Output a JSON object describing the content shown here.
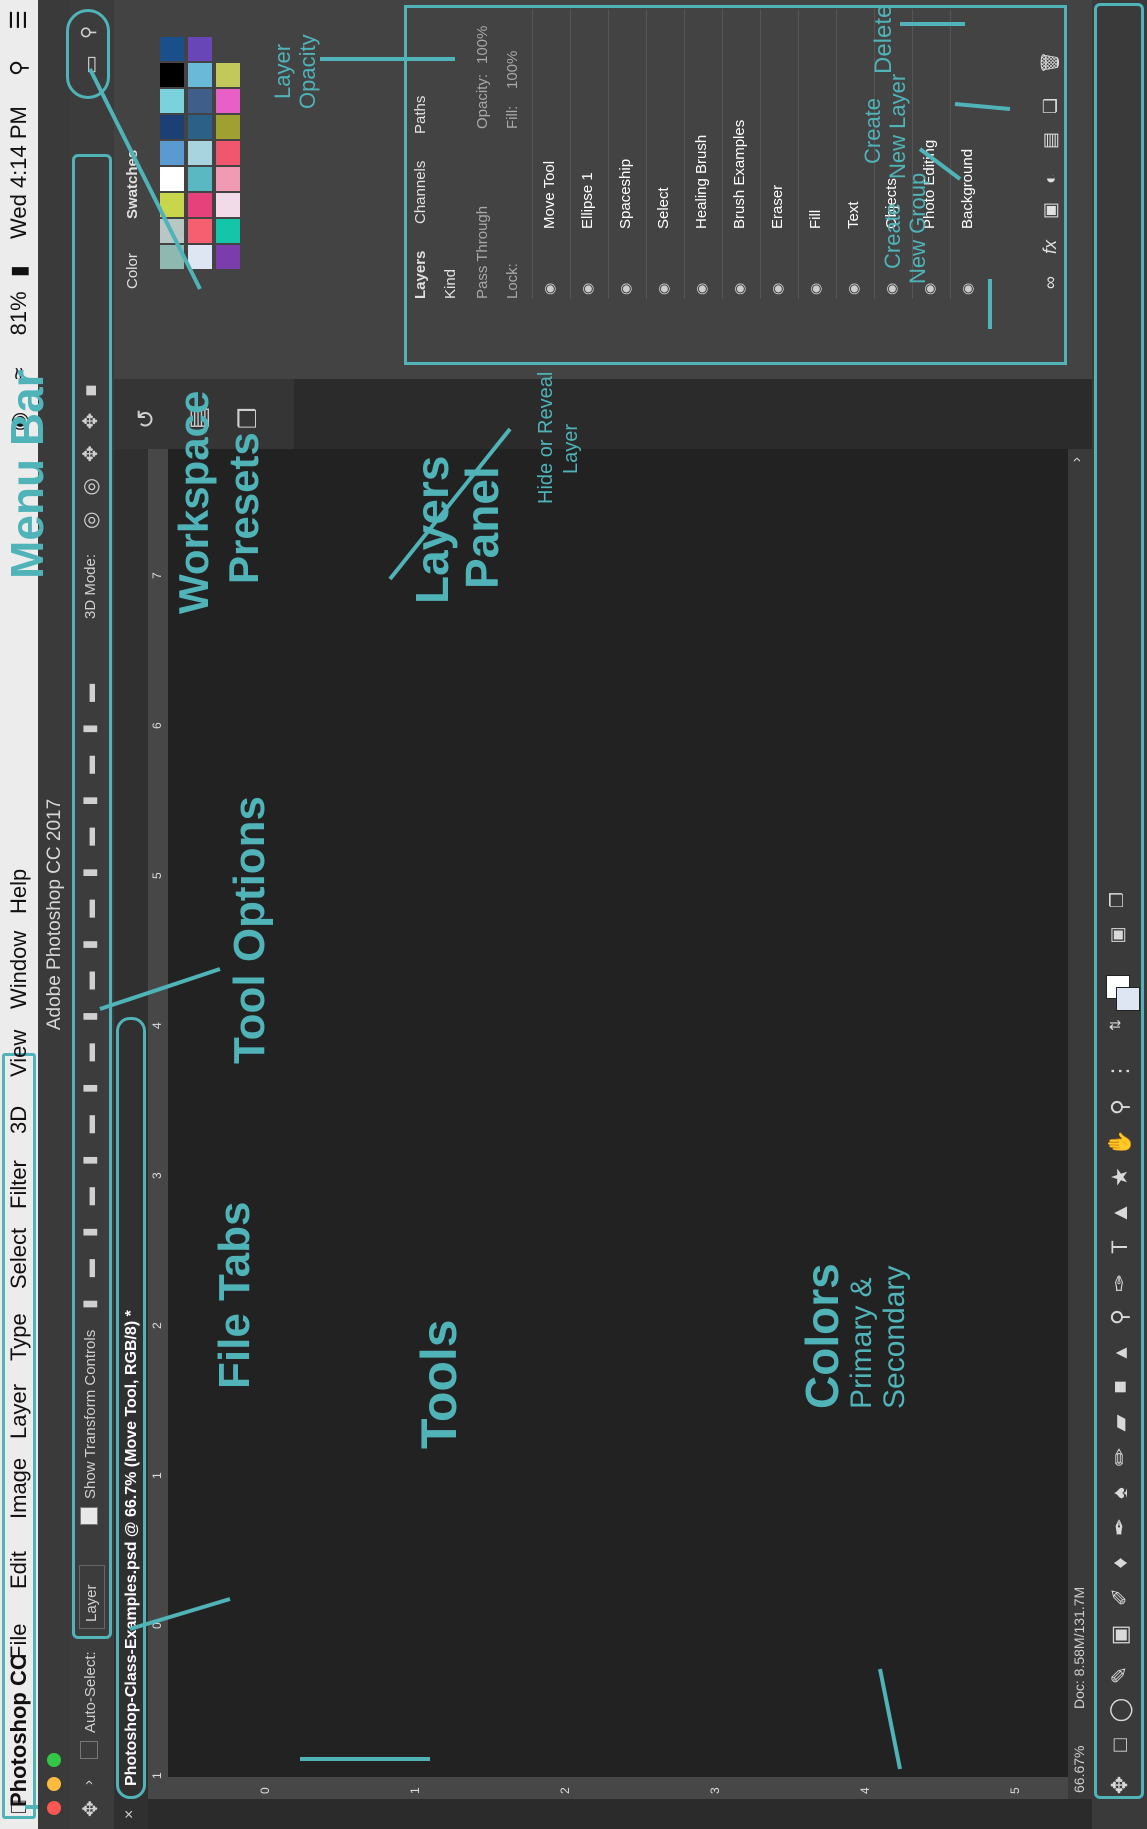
{
  "menubar": {
    "apple": "",
    "items": [
      "Photoshop CC",
      "File",
      "Edit",
      "Image",
      "Layer",
      "Type",
      "Select",
      "Filter",
      "3D",
      "View",
      "Window",
      "Help"
    ],
    "battery": "81%",
    "clock": "Wed 4:14 PM"
  },
  "app": {
    "title": "Adobe Photoshop CC 2017"
  },
  "options": {
    "auto_select_label": "Auto-Select:",
    "auto_select_value": "Layer",
    "transform_label": "Show Transform Controls",
    "mode_label": "3D Mode:"
  },
  "file_tab": {
    "label": "Photoshop-Class-Examples.psd @ 66.7% (Move Tool, RGB/8) *"
  },
  "status": {
    "zoom": "66.67%",
    "doc": "Doc: 8.58M/131.7M"
  },
  "ruler_ticks": [
    "1",
    "0",
    "1",
    "2",
    "3",
    "4",
    "5",
    "6",
    "7"
  ],
  "vruler_ticks": [
    "0",
    "1",
    "2",
    "3",
    "4",
    "5"
  ],
  "panels": {
    "top_tabs": [
      "Color",
      "Swatches"
    ],
    "layer_tabs": [
      "Layers",
      "Channels",
      "Paths"
    ],
    "kind": "Kind",
    "blend": "Pass Through",
    "opacity_label": "Opacity:",
    "opacity_value": "100%",
    "lock_label": "Lock:",
    "fill_label": "Fill:",
    "fill_value": "100%",
    "layers": [
      "Move Tool",
      "Ellipse 1",
      "Spaceship",
      "Select",
      "Healing Brush",
      "Brush Examples",
      "Eraser",
      "Fill",
      "Text",
      "Objects",
      "Photo Editing",
      "Background"
    ]
  },
  "swatch_colors": [
    "#8fb9b0",
    "#b9c7c4",
    "#c9d64b",
    "#ffffff",
    "#5b9ad0",
    "#1c3f74",
    "#7ad3dc",
    "#000000",
    "#1b4f8a",
    "#dfe6f3",
    "#f55f6f",
    "#e7417c",
    "#5ab8c3",
    "#a8d4e0",
    "#2c6086",
    "#3f5f8a",
    "#6ab9d8",
    "#6846b7",
    "#7a3dab",
    "#14c5a9",
    "#f2dbe9",
    "#f19ab3",
    "#f0566d",
    "#a09f31",
    "#e95fc8",
    "#c3c85a"
  ],
  "annotations": {
    "menu_bar": "Menu Bar",
    "workspace": [
      "Workspace",
      "Presets"
    ],
    "tool_options": "Tool Options",
    "file_tabs": "File Tabs",
    "tools": "Tools",
    "layers_panel": [
      "Layers",
      "Panel"
    ],
    "hide_reveal": [
      "Hide or Reveal",
      "Layer"
    ],
    "layer_opacity": [
      "Layer",
      "Opacity"
    ],
    "delete": "Delete",
    "create_layer": [
      "Create",
      "New Layer"
    ],
    "create_group": [
      "Create",
      "New Group"
    ],
    "colors": "Colors",
    "colors_sub": [
      "Primary &",
      "Secondary"
    ]
  },
  "accent": "#4fb3b8"
}
